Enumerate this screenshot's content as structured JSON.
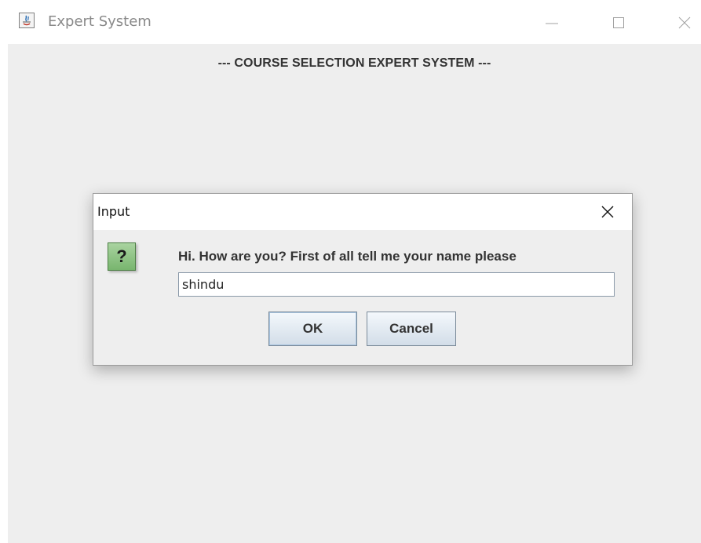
{
  "window": {
    "title": "Expert System",
    "icon": "java-icon",
    "controls": [
      "minimize-icon",
      "maximize-icon",
      "close-icon"
    ]
  },
  "app": {
    "heading": "--- COURSE SELECTION EXPERT SYSTEM ---"
  },
  "dialog": {
    "title": "Input",
    "icon": "question-icon",
    "icon_glyph": "?",
    "prompt": "Hi. How are you? First of all tell me your name please",
    "input_value": "shindu",
    "ok_label": "OK",
    "cancel_label": "Cancel"
  },
  "colors": {
    "content_background": "#eeeeee",
    "icon_green": "#8ec585",
    "button_top": "#f4f8fc",
    "button_bottom": "#d2dde8"
  }
}
